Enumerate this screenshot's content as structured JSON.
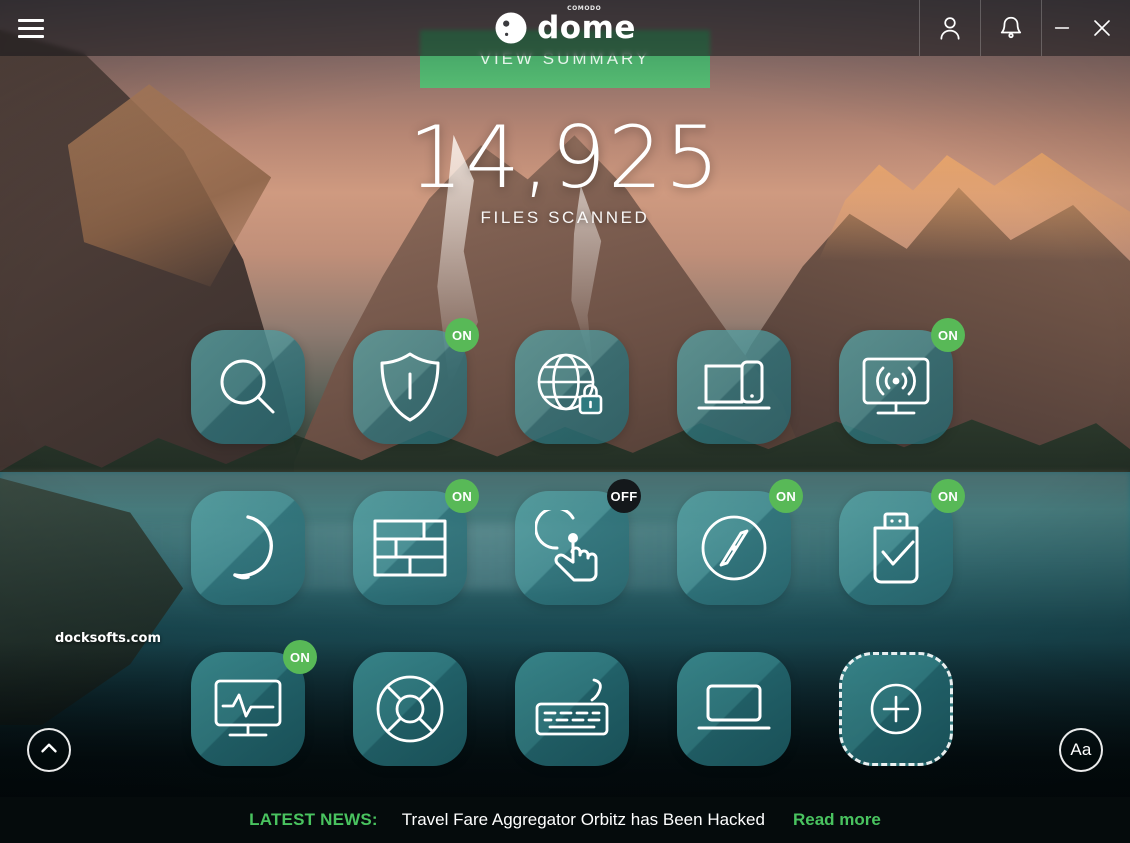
{
  "window": {
    "title": "dome",
    "logo_superscript": "COMODO",
    "menu_icon": "hamburger-menu-icon",
    "account_icon": "user-account-icon",
    "notifications_icon": "bell-notification-icon",
    "minimize_label": "–",
    "close_label": "✕"
  },
  "hero": {
    "summary_button": "VIEW SUMMARY",
    "scan_count": "14,925",
    "scan_label": "FILES SCANNED"
  },
  "tiles": [
    {
      "name": "scan",
      "icon": "magnifier-search-icon",
      "badge": null
    },
    {
      "name": "antivirus",
      "icon": "shield-security-icon",
      "badge": "ON"
    },
    {
      "name": "secure-dns",
      "icon": "globe-lock-icon",
      "badge": null
    },
    {
      "name": "device-manager",
      "icon": "laptop-phone-icon",
      "badge": null
    },
    {
      "name": "secure-wifi",
      "icon": "monitor-wifi-icon",
      "badge": "ON"
    },
    {
      "name": "headset-support",
      "icon": "headset-ring-icon",
      "badge": null
    },
    {
      "name": "firewall",
      "icon": "brick-wall-firewall-icon",
      "badge": "ON"
    },
    {
      "name": "touch-control",
      "icon": "touch-finger-icon",
      "badge": "OFF"
    },
    {
      "name": "secure-browser",
      "icon": "compass-browser-icon",
      "badge": "ON"
    },
    {
      "name": "usb-protection",
      "icon": "usb-check-icon",
      "badge": "ON"
    },
    {
      "name": "system-monitor",
      "icon": "monitor-pulse-icon",
      "badge": "ON"
    },
    {
      "name": "help-support",
      "icon": "lifebuoy-support-icon",
      "badge": null
    },
    {
      "name": "virtual-keyboard",
      "icon": "keyboard-icon",
      "badge": null
    },
    {
      "name": "virtual-desktop",
      "icon": "laptop-icon",
      "badge": null
    },
    {
      "name": "add-app",
      "icon": "plus-circle-icon",
      "badge": null
    }
  ],
  "controls": {
    "scroll_up_icon": "chevron-up-icon",
    "text_size_label": "Aa"
  },
  "watermark": "docksofts.com",
  "news": {
    "label": "LATEST NEWS:",
    "headline": "Travel Fare Aggregator Orbitz has Been Hacked",
    "link": "Read more"
  },
  "colors": {
    "badge_on": "#58b957",
    "badge_off": "#14181b",
    "accent_green": "#49c35f",
    "tile_teal": "#4a969b"
  }
}
